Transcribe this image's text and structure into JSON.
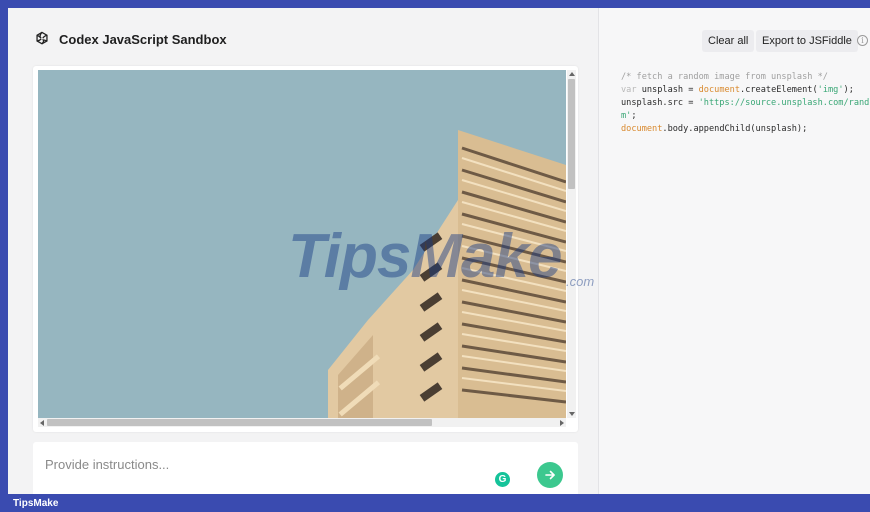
{
  "header": {
    "title": "Codex JavaScript Sandbox",
    "logo_icon": "openai-logo-icon"
  },
  "toolbar": {
    "clear_label": "Clear all",
    "export_label": "Export to JSFiddle",
    "info_icon": "info-icon"
  },
  "code": {
    "line1": "/* fetch a random image from unsplash */",
    "line2_kw": "var",
    "line2_a": " unsplash = ",
    "line2_obj": "document",
    "line2_b": ".createElement(",
    "line2_str": "'img'",
    "line2_c": ");",
    "line3_a": "unsplash.src = ",
    "line3_str1": "'https://source.unsplash.com/rando",
    "line4_str": "m'",
    "line4_b": ";",
    "line5_obj": "document",
    "line5_b": ".body.appendChild(unsplash);"
  },
  "prompt": {
    "placeholder": "Provide instructions..."
  },
  "grammarly": {
    "letter": "G"
  },
  "watermark": {
    "text": "TipsMake",
    "suffix": ".com"
  },
  "footer": {
    "label": "TipsMake"
  },
  "colors": {
    "accent": "#3a4bb0",
    "send": "#3cc88f",
    "sky": "#8fb1bd"
  }
}
